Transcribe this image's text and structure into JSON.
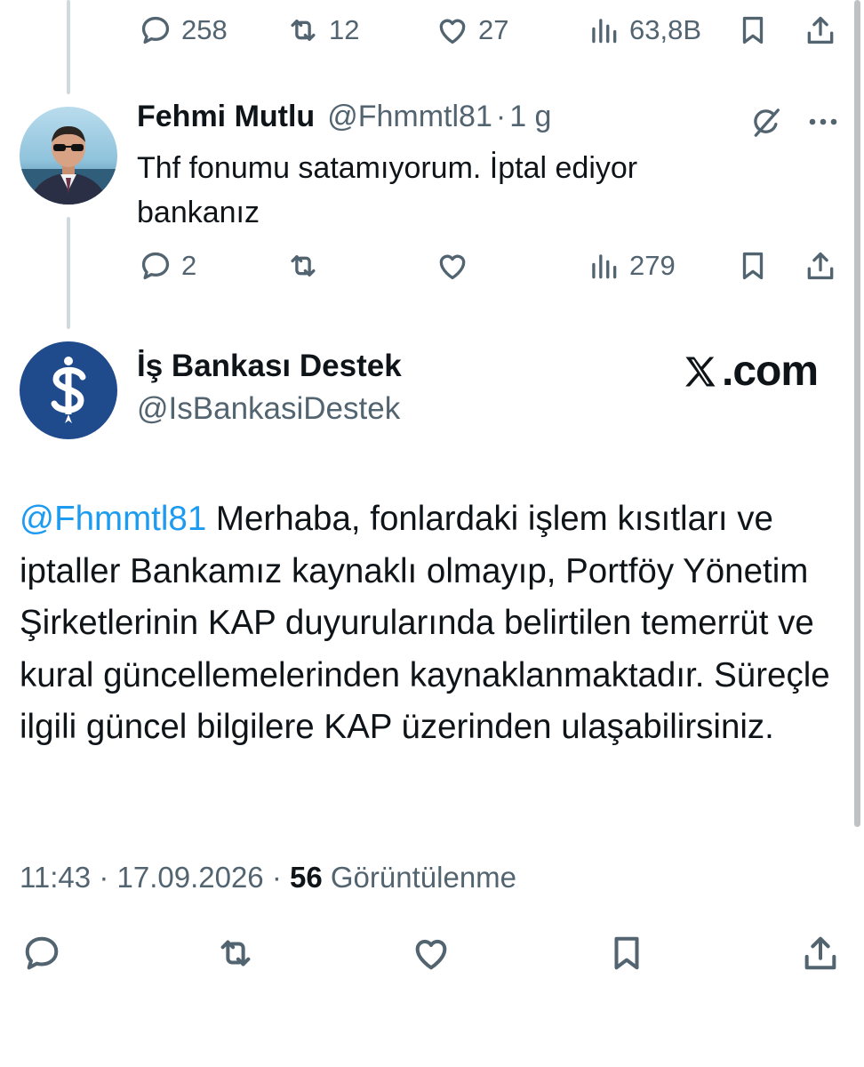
{
  "top_actions": {
    "replies": "258",
    "reposts": "12",
    "likes": "27",
    "views": "63,8B"
  },
  "reply": {
    "name": "Fehmi Mutlu",
    "handle": "@Fhmmtl81",
    "separator": "·",
    "time": "1 g",
    "text": "Thf fonumu satamıyorum. İptal ediyor bankanız",
    "actions": {
      "replies": "2",
      "reposts": "",
      "likes": "",
      "views": "279"
    }
  },
  "main": {
    "name": "İş Bankası Destek",
    "handle": "@IsBankasiDestek",
    "brand_suffix": ".com",
    "mention": "@Fhmmtl81",
    "text": " Merhaba, fonlardaki işlem kısıtları ve iptaller Bankamız kaynaklı olmayıp, Portföy Yönetim Şirketlerinin KAP duyurularında belirtilen temerrüt ve kural güncellemelerinden kaynaklanmaktadır. Süreçle ilgili güncel bilgilere KAP üzerinden ulaşabilirsiniz.",
    "time": "11:43",
    "date": "17.09.2026",
    "dot": "·",
    "views_count": "56",
    "views_label": "Görüntülenme"
  },
  "colors": {
    "text": "#0f1419",
    "secondary": "#536471",
    "link": "#1d9bf0",
    "thread_line": "#cfd9de",
    "isbank_blue": "#1f4a8c"
  },
  "icons": [
    "reply-icon",
    "repost-icon",
    "like-icon",
    "views-icon",
    "bookmark-icon",
    "share-icon",
    "grok-icon",
    "more-icon",
    "x-logo-icon"
  ]
}
